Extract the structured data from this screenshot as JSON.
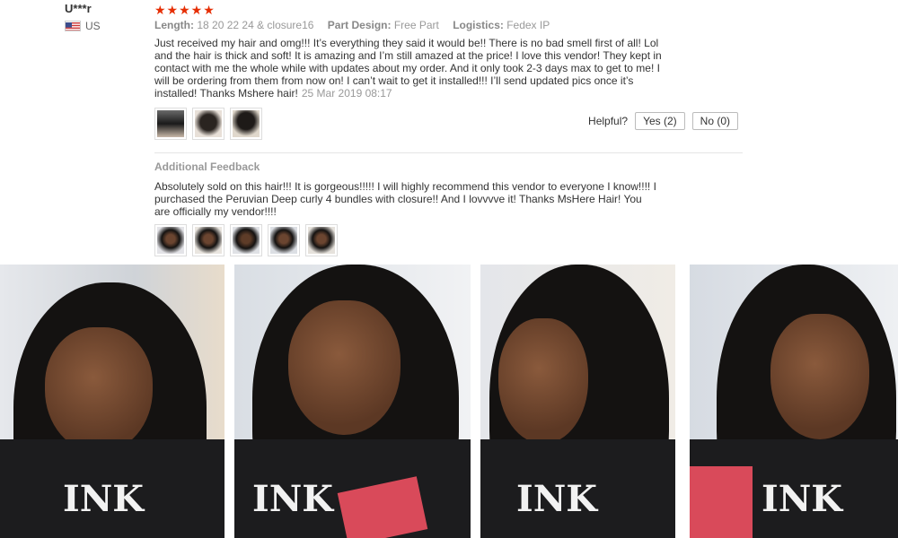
{
  "reviewer": {
    "name": "U***r",
    "country": "US",
    "rating_stars": "★★★★★",
    "rating": 5
  },
  "meta": [
    {
      "key": "Length:",
      "value": "18 20 22 24 & closure16"
    },
    {
      "key": "Part Design:",
      "value": "Free Part"
    },
    {
      "key": "Logistics:",
      "value": "Fedex IP"
    }
  ],
  "review": {
    "text": "Just received my hair and omg!!! It’s everything they said it would be!! There is no bad smell first of all! Lol and the hair is thick and soft! It is amazing and I’m still amazed at the price! I love this vendor! They kept in contact with me the whole while with updates about my order. And it only took 2-3 days max to get to me! I will be ordering from them from now on! I can’t wait to get it installed!!! I’ll send updated pics once it’s installed! Thanks Mshere hair!",
    "date": "25 Mar 2019 08:17"
  },
  "helpful": {
    "label": "Helpful?",
    "yes": "Yes (2)",
    "no": "No (0)"
  },
  "additional": {
    "title": "Additional Feedback",
    "text": "Absolutely sold on this hair!!! It is gorgeous!!!!! I will highly recommend this vendor to everyone I know!!!! I purchased the Peruvian Deep curly 4 bundles with closure!! And I lovvvve it! Thanks MsHere Hair! You are officially my vendor!!!!"
  },
  "colors": {
    "stars": "#e62e04",
    "hair": "#141211",
    "shirt": "#1c1c1e"
  }
}
